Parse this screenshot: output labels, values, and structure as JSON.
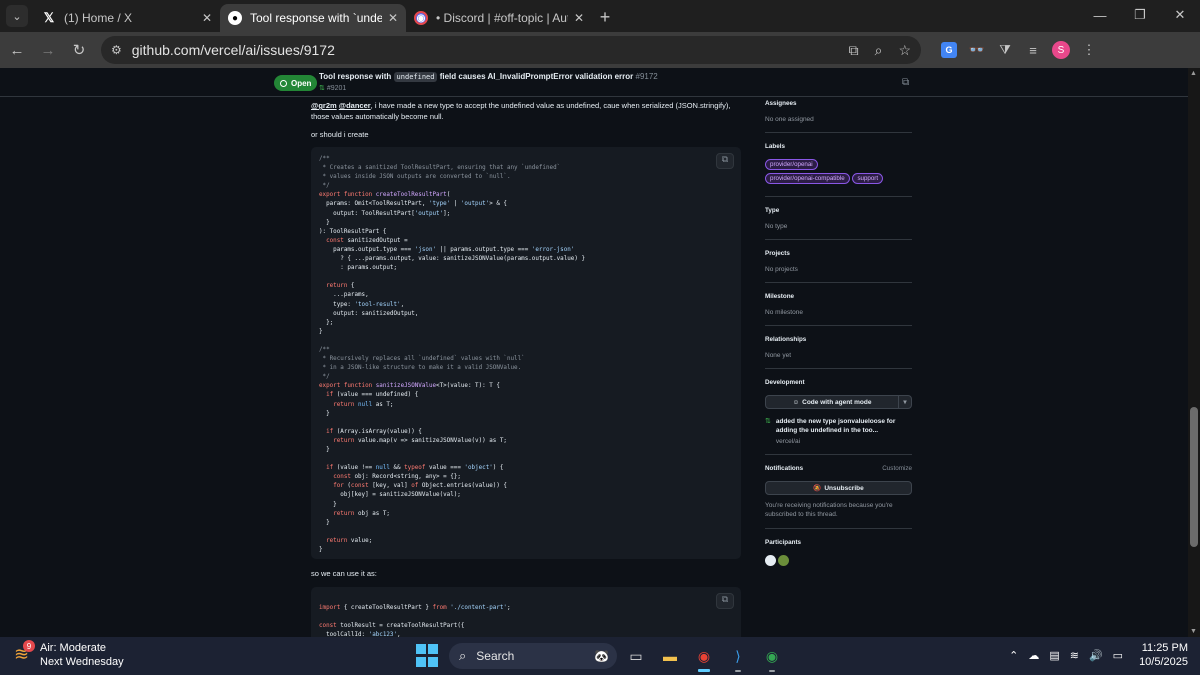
{
  "browser": {
    "tabs": [
      {
        "title": "(1) Home / X",
        "icon": "x-icon"
      },
      {
        "title": "Tool response with `undefined`",
        "icon": "github-icon"
      },
      {
        "title": "• Discord | #off-topic | Autumn",
        "icon": "discord-icon"
      }
    ],
    "url": "github.com/vercel/ai/issues/9172"
  },
  "issue_header": {
    "status": "Open",
    "title_prefix": "Tool response with",
    "title_code": "undefined",
    "title_suffix": "field causes AI_InvalidPromptError validation error",
    "number": "#9172",
    "linked_pr": "#9201"
  },
  "comment": {
    "mention1": "@gr2m",
    "mention2": "@dancer",
    "text1": ", i have made a new type to accept the undefined value as undefined, caue when serialized (JSON.stringify), those values automatically become null.",
    "text2": "or should i create",
    "text3": "so we can use it as:"
  },
  "sidebar": {
    "assignees_label": "Assignees",
    "assignees_value": "No one assigned",
    "labels_label": "Labels",
    "labels": [
      "provider/openai",
      "provider/openai-compatible",
      "support"
    ],
    "type_label": "Type",
    "type_value": "No type",
    "projects_label": "Projects",
    "projects_value": "No projects",
    "milestone_label": "Milestone",
    "milestone_value": "No milestone",
    "relationships_label": "Relationships",
    "relationships_value": "None yet",
    "development_label": "Development",
    "agent_button": "Code with agent mode",
    "dev_pr_title": "added the new type jsonvalueloose for adding the undefined in the too...",
    "dev_pr_repo": "vercel/ai",
    "notifications_label": "Notifications",
    "customize": "Customize",
    "unsubscribe": "Unsubscribe",
    "notif_reason": "You're receiving notifications because you're subscribed to this thread.",
    "participants_label": "Participants"
  },
  "taskbar": {
    "weather_title": "Air: Moderate",
    "weather_sub": "Next Wednesday",
    "weather_badge": "9",
    "search_label": "Search",
    "time": "11:25 PM",
    "date": "10/5/2025"
  }
}
